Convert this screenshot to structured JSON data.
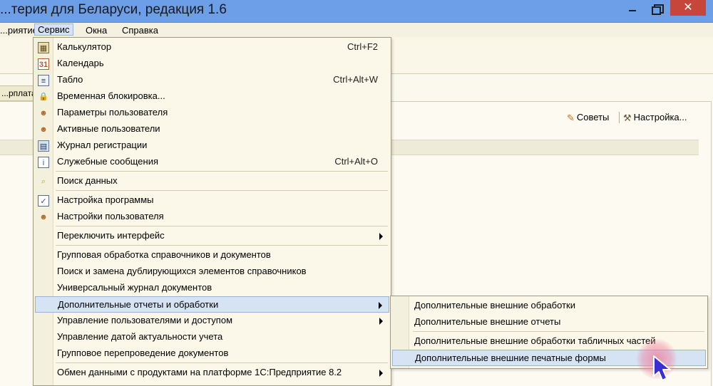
{
  "window": {
    "title": "...терия для Беларуси, редакция 1.6",
    "minimize_icon": "minimize-icon",
    "maximize_icon": "maximize-icon",
    "close_glyph": "✕"
  },
  "menubar": {
    "items": [
      {
        "label": "...риятие"
      },
      {
        "label": "Сервис",
        "active": true
      },
      {
        "label": "Окна"
      },
      {
        "label": "Справка"
      }
    ]
  },
  "background": {
    "doc_tab": "...рплата",
    "links": {
      "tips": "Советы",
      "settings": "Настройка..."
    }
  },
  "service_menu": {
    "items": [
      {
        "label": "Калькулятор",
        "shortcut": "Ctrl+F2",
        "icon": "calculator-icon"
      },
      {
        "label": "Календарь",
        "shortcut": "",
        "icon": "calendar-icon"
      },
      {
        "label": "Табло",
        "shortcut": "Ctrl+Alt+W",
        "icon": "board-icon"
      },
      {
        "label": "Временная блокировка...",
        "shortcut": "",
        "icon": "lock-user-icon"
      },
      {
        "label": "Параметры пользователя",
        "shortcut": "",
        "icon": "user-params-icon"
      },
      {
        "label": "Активные пользователи",
        "shortcut": "",
        "icon": "active-users-icon"
      },
      {
        "label": "Журнал регистрации",
        "shortcut": "",
        "icon": "log-icon"
      },
      {
        "label": "Служебные сообщения",
        "shortcut": "Ctrl+Alt+O",
        "icon": "messages-icon"
      },
      {
        "label": "Поиск данных",
        "shortcut": "",
        "icon": "search-data-icon"
      },
      {
        "label": "Настройка программы",
        "shortcut": "",
        "icon": "program-settings-icon"
      },
      {
        "label": "Настройки пользователя",
        "shortcut": "",
        "icon": "user-settings-icon"
      },
      {
        "label": "Переключить интерфейс",
        "shortcut": "",
        "submenu": true
      },
      {
        "label": "Групповая обработка справочников и документов"
      },
      {
        "label": "Поиск и замена дублирующихся элементов справочников"
      },
      {
        "label": "Универсальный журнал документов"
      },
      {
        "label": "Дополнительные отчеты и обработки",
        "submenu": true,
        "highlighted": true
      },
      {
        "label": "Управление пользователями и доступом",
        "submenu": true
      },
      {
        "label": "Управление датой актуальности учета"
      },
      {
        "label": "Групповое перепроведение документов"
      },
      {
        "label": "Обмен данными с продуктами на платформе 1С:Предприятие 8.2",
        "submenu": true
      }
    ]
  },
  "submenu": {
    "items": [
      {
        "label": "Дополнительные внешние обработки"
      },
      {
        "label": "Дополнительные внешние отчеты"
      },
      {
        "label": "Дополнительные внешние обработки табличных частей"
      },
      {
        "label": "Дополнительные внешние печатные формы",
        "highlighted": true
      }
    ]
  },
  "colors": {
    "titlebar": "#6d9fe8",
    "highlight": "#d6e3f4",
    "close_button": "#c7463c",
    "cursor": "#3a2fd4"
  }
}
